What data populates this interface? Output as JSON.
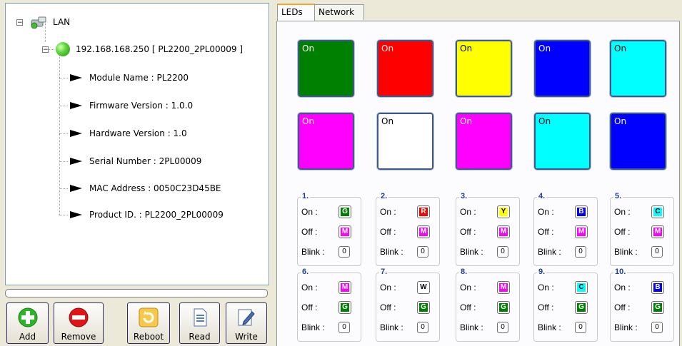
{
  "tree": {
    "root_label": "LAN",
    "device_label": "192.168.168.250 [ PL2200_2PL00009 ]",
    "properties": [
      "Module Name : PL2200",
      "Firmware Version : 1.0.0",
      "Hardware Version : 1.0",
      "Serial Number : 2PL00009",
      "MAC Address : 0050C23D45BE",
      "Product ID. : PL2200_2PL00009"
    ]
  },
  "toolbar": {
    "add_label": "Add",
    "remove_label": "Remove",
    "reboot_label": "Reboot",
    "read_label": "Read",
    "write_label": "Write"
  },
  "tabs": [
    "LEDs",
    "Network"
  ],
  "led_swatches": [
    {
      "label": "On",
      "color": "#008000",
      "text_color": "#ffffff"
    },
    {
      "label": "On",
      "color": "#ff0000",
      "text_color": "#ffffff"
    },
    {
      "label": "On",
      "color": "#ffff00",
      "text_color": "#000000"
    },
    {
      "label": "On",
      "color": "#0000ff",
      "text_color": "#ffffff"
    },
    {
      "label": "On",
      "color": "#00ffff",
      "text_color": "#000000"
    },
    {
      "label": "On",
      "color": "#ff00ff",
      "text_color": "#ffffff"
    },
    {
      "label": "On",
      "color": "#ffffff",
      "text_color": "#000000"
    },
    {
      "label": "On",
      "color": "#ff00ff",
      "text_color": "#ffffff"
    },
    {
      "label": "On",
      "color": "#00ffff",
      "text_color": "#000000"
    },
    {
      "label": "On",
      "color": "#0000ff",
      "text_color": "#ffffff"
    }
  ],
  "row_labels": {
    "on": "On :",
    "off": "Off :",
    "blink": "Blink :"
  },
  "led_groups": [
    {
      "title": "1.",
      "on": {
        "letter": "G",
        "color": "#008000",
        "text_color": "#ffffff"
      },
      "off": {
        "letter": "M",
        "color": "#ff00ff",
        "text_color": "#ffffff"
      },
      "blink": "0"
    },
    {
      "title": "2.",
      "on": {
        "letter": "R",
        "color": "#ff0000",
        "text_color": "#ffffff"
      },
      "off": {
        "letter": "M",
        "color": "#ff00ff",
        "text_color": "#ffffff"
      },
      "blink": "0"
    },
    {
      "title": "3.",
      "on": {
        "letter": "Y",
        "color": "#ffff00",
        "text_color": "#000000"
      },
      "off": {
        "letter": "M",
        "color": "#ff00ff",
        "text_color": "#ffffff"
      },
      "blink": "0"
    },
    {
      "title": "4.",
      "on": {
        "letter": "B",
        "color": "#0000ff",
        "text_color": "#ffffff"
      },
      "off": {
        "letter": "M",
        "color": "#ff00ff",
        "text_color": "#ffffff"
      },
      "blink": "0"
    },
    {
      "title": "5.",
      "on": {
        "letter": "C",
        "color": "#00ffff",
        "text_color": "#000000"
      },
      "off": {
        "letter": "M",
        "color": "#ff00ff",
        "text_color": "#ffffff"
      },
      "blink": "0"
    },
    {
      "title": "6.",
      "on": {
        "letter": "M",
        "color": "#ff00ff",
        "text_color": "#ffffff"
      },
      "off": {
        "letter": "G",
        "color": "#008000",
        "text_color": "#ffffff"
      },
      "blink": "0"
    },
    {
      "title": "7.",
      "on": {
        "letter": "W",
        "color": "#ffffff",
        "text_color": "#000000"
      },
      "off": {
        "letter": "G",
        "color": "#008000",
        "text_color": "#ffffff"
      },
      "blink": "0"
    },
    {
      "title": "8.",
      "on": {
        "letter": "M",
        "color": "#ff00ff",
        "text_color": "#ffffff"
      },
      "off": {
        "letter": "G",
        "color": "#008000",
        "text_color": "#ffffff"
      },
      "blink": "0"
    },
    {
      "title": "9.",
      "on": {
        "letter": "C",
        "color": "#00ffff",
        "text_color": "#000000"
      },
      "off": {
        "letter": "G",
        "color": "#008000",
        "text_color": "#ffffff"
      },
      "blink": "0"
    },
    {
      "title": "10.",
      "on": {
        "letter": "B",
        "color": "#0000ff",
        "text_color": "#ffffff"
      },
      "off": {
        "letter": "G",
        "color": "#008000",
        "text_color": "#ffffff"
      },
      "blink": "0"
    }
  ]
}
